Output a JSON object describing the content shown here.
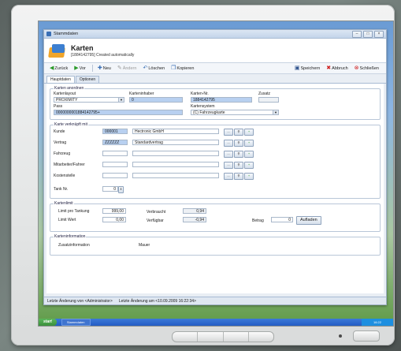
{
  "window": {
    "title": "Stammdaten",
    "btn_min": "–",
    "btn_max": "□",
    "btn_close": "×"
  },
  "header": {
    "title": "Karten",
    "subtitle": "[1884142795] Created automatically"
  },
  "toolbar": {
    "back": "Zurück",
    "forward": "Vor",
    "new": "Neu",
    "edit": "Ändern",
    "delete": "Löschen",
    "copy": "Kopieren",
    "save": "Speichern",
    "cancel": "Abbruch",
    "close": "Schließen"
  },
  "tabs": [
    "Hauptdaten",
    "Optionen"
  ],
  "card_create": {
    "legend": "Karten anordnen",
    "layout_label": "Kartenlayout",
    "layout_value": "PROXIMITY",
    "holder_label": "Karteninhaber",
    "holder_value": "0",
    "cardno_label": "Karten-Nr.",
    "cardno_value": "1884142795",
    "extra_label": "Zusatz",
    "extra_value": "",
    "pass_label": "Pass",
    "pass_value": "0000000001884142795+",
    "system_label": "Kartensystem",
    "system_value": "(C) Fahrzeugkarte"
  },
  "links": {
    "legend": "Karte verknüpft mit",
    "rows": [
      {
        "label": "Kunde",
        "code": "000001",
        "name": "Hectronic GmbH",
        "code_blue": true,
        "has_buttons": true
      },
      {
        "label": "Vertrag",
        "code": "ZZZZZZ",
        "name": "Standardvertrag",
        "code_blue": true,
        "has_buttons": true
      },
      {
        "label": "Fahrzeug",
        "code": "",
        "name": "",
        "code_blue": false,
        "has_buttons": true
      },
      {
        "label": "Mitarbeiter/Fahrer",
        "code": "",
        "name": "",
        "code_blue": false,
        "has_buttons": true
      },
      {
        "label": "Kostenstelle",
        "code": "",
        "name": "",
        "code_blue": false,
        "has_buttons": true
      }
    ],
    "tank_label": "Tank Nr.",
    "tank_value": "0",
    "btn_dots": "...",
    "btn_search": "⚲",
    "btn_plus": "+"
  },
  "limit": {
    "legend": "Kartenlimit",
    "per_fuel_label": "Limit pro Tankung",
    "per_fuel_value": "999,00",
    "value_label": "Limit Wert",
    "value_value": "0,00",
    "used_label": "Verbraucht",
    "used_value": "0,94",
    "available_label": "Verfügbar",
    "available_value": "-0,94",
    "amount_label": "Betrag",
    "amount_value": "0",
    "charge_button": "Aufladen"
  },
  "info": {
    "legend": "Karteninformation",
    "extra_label": "Zusatzinformation",
    "extra_value": "Mauer"
  },
  "status": {
    "last_change_by": "Letzte Änderung von <Administrator>",
    "last_change_at": "Letzte Änderung am <10.09.2009 16:22:34>"
  },
  "taskbar": {
    "start": "start",
    "task": "Stammdaten",
    "tray": "16:22"
  },
  "colors": {
    "accent_blue": "#b8d0f0",
    "title_bar": "#c3d4ea",
    "desktop": "#5f9a47"
  }
}
